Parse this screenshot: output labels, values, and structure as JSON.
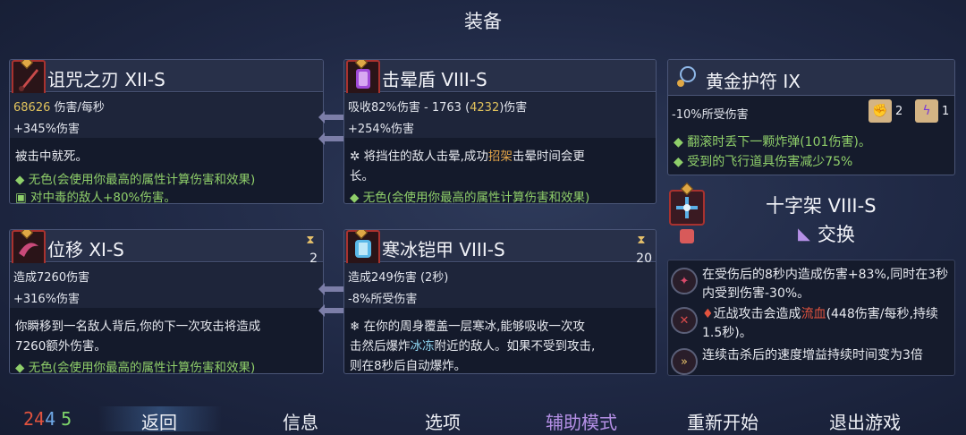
{
  "screen_title": "装备",
  "cards": {
    "curse_blade": {
      "name": "诅咒之刃 XII-S",
      "dps_value": "68626",
      "dps_unit": " 伤害/每秒",
      "bonus": "+345%伤害",
      "desc1": "被击中就死。",
      "desc2": "无色(会使用你最高的属性计算伤害和效果)",
      "desc3": "对中毒的敌人+80%伤害。"
    },
    "stun_shield": {
      "name": "击晕盾 VIII-S",
      "line1_a": "吸收82%伤害 - 1763 (",
      "line1_b": "4232",
      "line1_c": ")伤害",
      "bonus": "+254%伤害",
      "desc1_a": "将挡住的敌人击晕,成功",
      "desc1_b": "招架",
      "desc1_c": "击晕时间会更",
      "desc2": "长。",
      "desc3": "无色(会使用你最高的属性计算伤害和效果)"
    },
    "blink": {
      "name": "位移 XI-S",
      "cooldown": "2",
      "line1": "造成7260伤害",
      "bonus": "+316%伤害",
      "desc1": "你瞬移到一名敌人背后,你的下一次攻击将造成",
      "desc2": "7260额外伤害。",
      "desc3": "无色(会使用你最高的属性计算伤害和效果)"
    },
    "frost_armor": {
      "name": "寒冰铠甲 VIII-S",
      "cooldown": "20",
      "line1": "造成249伤害 (2秒)",
      "bonus": "-8%所受伤害",
      "desc1": "在你的周身覆盖一层寒冰,能够吸收一次攻",
      "desc2_a": "击然后爆炸",
      "desc2_b": "冰冻",
      "desc2_c": "附近的敌人。如果不受到攻击,",
      "desc3": "则在8秒后自动爆炸。"
    },
    "amulet": {
      "name": "黄金护符 IX",
      "line1": "-10%所受伤害",
      "scroll1_count": "2",
      "scroll2_count": "1",
      "desc1": "翻滚时丢下一颗炸弹(101伤害)。",
      "desc2": "受到的飞行道具伤害减少75%"
    },
    "crossbow": {
      "name": "十字架 VIII-S",
      "swap_label": "交换",
      "fx1": "在受伤后的8秒内造成伤害+83%,同时在3秒内受到伤害-30%。",
      "fx2_a": "近战攻击会造成",
      "fx2_b": "流血",
      "fx2_c": "(448伤害/每秒,持续1.5秒)。",
      "fx3": "连续击杀后的速度增益持续时间变为3倍"
    }
  },
  "counters": {
    "red": "24",
    "blue": "4",
    "green": "5"
  },
  "menu": {
    "back": "返回",
    "info": "信息",
    "options": "选项",
    "assist": "辅助模式",
    "restart": "重新开始",
    "quit": "退出游戏"
  },
  "colors": {
    "accent_gold": "#e0c25c",
    "stat_green": "#8fcf6a",
    "counter_red": "#e2533e",
    "counter_blue": "#6fa8e6",
    "counter_green": "#7ed46a",
    "assist_purple": "#b590e6"
  }
}
